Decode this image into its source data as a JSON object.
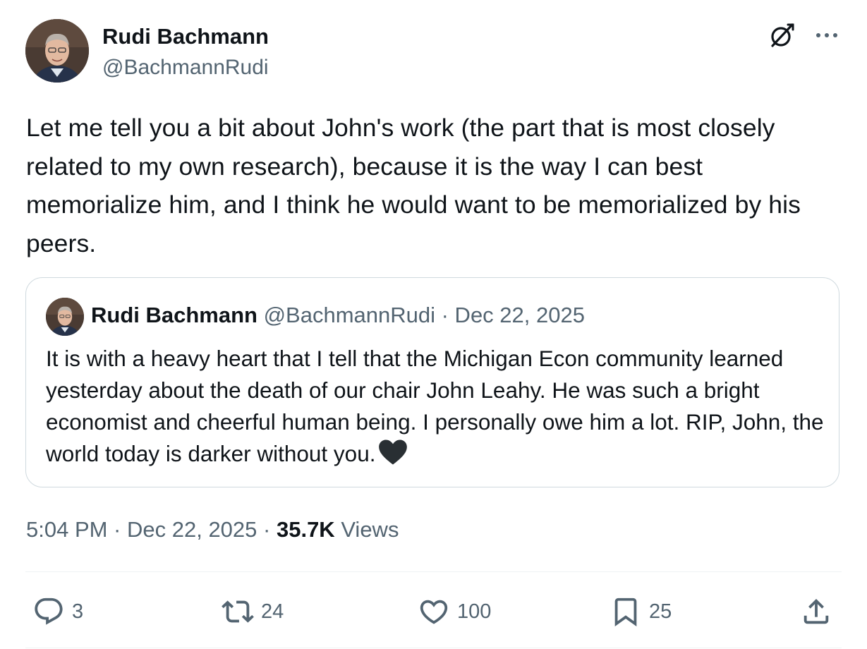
{
  "author": {
    "display_name": "Rudi Bachmann",
    "handle": "@BachmannRudi"
  },
  "tweet": {
    "text": "Let me tell you a bit about John's work (the part that is most closely related to my own research), because it is the way I can best memorialize him, and I think he would want to be memorialized by his peers."
  },
  "quoted_tweet": {
    "display_name": "Rudi Bachmann",
    "meta": " @BachmannRudi · Dec 22, 2025",
    "text": "It is with a heavy heart that I tell that the Michigan Econ community learned yesterday about the death of our chair John Leahy. He was such a bright economist and cheerful human being. I personally owe him a lot. RIP, John, the world today is darker without you.",
    "emoji": "black-heart-icon"
  },
  "metadata": {
    "time_date": "5:04 PM · Dec 22, 2025 · ",
    "views_count": "35.7K",
    "views_label": " Views"
  },
  "actions": {
    "replies": "3",
    "reposts": "24",
    "likes": "100",
    "bookmarks": "25"
  },
  "icons": {
    "top_right": [
      "grok-icon",
      "more-icon"
    ],
    "action_bar": [
      "reply-icon",
      "repost-icon",
      "like-icon",
      "bookmark-icon",
      "share-icon"
    ]
  },
  "colors": {
    "primary_text": "#0f1419",
    "secondary_text": "#536471",
    "border": "#cfd9de",
    "divider": "#eff3f4"
  }
}
